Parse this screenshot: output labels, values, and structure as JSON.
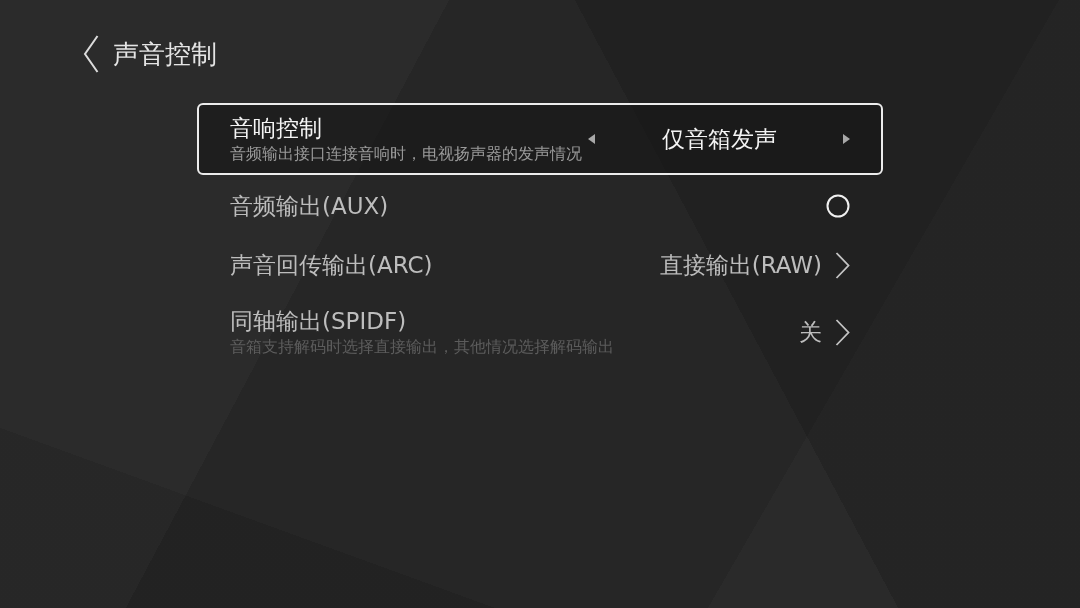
{
  "header": {
    "title": "声音控制"
  },
  "settings": [
    {
      "kind": "selector",
      "label": "音响控制",
      "description": "音频输出接口连接音响时，电视扬声器的发声情况",
      "value": "仅音箱发声",
      "selected": true
    },
    {
      "kind": "toggle",
      "label": "音频输出(AUX)",
      "on": false,
      "selected": false
    },
    {
      "kind": "link",
      "label": "声音回传输出(ARC)",
      "value": "直接输出(RAW)",
      "selected": false
    },
    {
      "kind": "link",
      "label": "同轴输出(SPIDF)",
      "description": "音箱支持解码时选择直接输出，其他情况选择解码输出",
      "value": "关",
      "selected": false
    }
  ]
}
